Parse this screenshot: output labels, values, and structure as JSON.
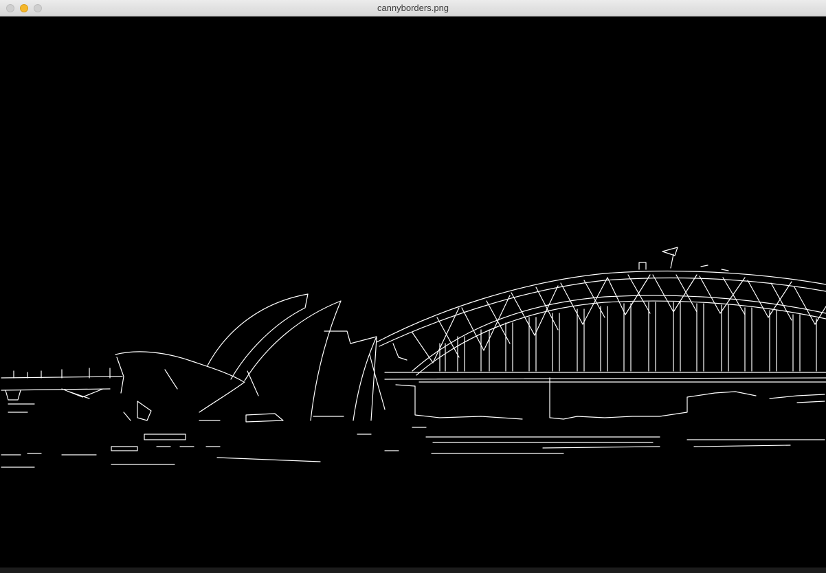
{
  "window": {
    "title": "cannyborders.png"
  },
  "image": {
    "description_icon": "edge-detection-image",
    "background_color": "#000000",
    "edge_color": "#ffffff"
  }
}
